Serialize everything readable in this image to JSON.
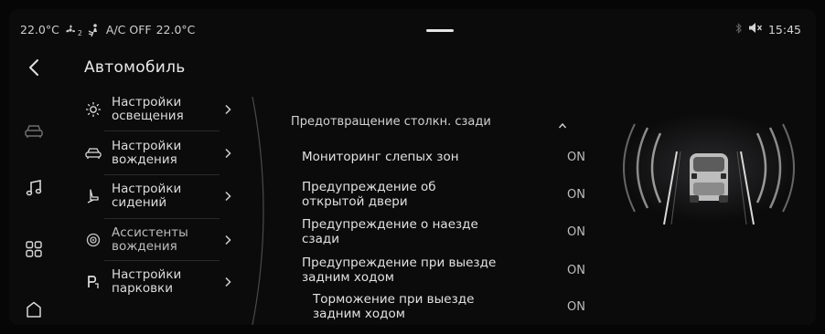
{
  "status": {
    "climate_left": "22.0°C",
    "fan_level": "2",
    "ac_status": "A/C OFF",
    "climate_right": "22.0°C",
    "time": "15:45"
  },
  "page": {
    "title": "Автомобиль"
  },
  "menu": [
    {
      "label": "Настройки\nосвещения",
      "icon": "sun-icon"
    },
    {
      "label": "Настройки\nвождения",
      "icon": "steering-car-icon"
    },
    {
      "label": "Настройки\nсидений",
      "icon": "seat-icon"
    },
    {
      "label": "Ассистенты\nвождения",
      "icon": "assist-target-icon"
    },
    {
      "label": "Настройки\nпарковки",
      "icon": "parking-icon"
    }
  ],
  "section": {
    "title": "Предотвращение столкн. сзади",
    "rows": [
      {
        "label": "Мониторинг слепых зон",
        "value": "ON"
      },
      {
        "label": "Предупреждение об\nоткрытой двери",
        "value": "ON"
      },
      {
        "label": "Предупреждение о наезде\nсзади",
        "value": "ON"
      },
      {
        "label": "Предупреждение при выезде\nзадним ходом",
        "value": "ON"
      },
      {
        "label": "Торможение при выезде\nзадним ходом",
        "value": "ON"
      }
    ]
  },
  "icons": {
    "back": "back-arrow-icon",
    "rail": [
      "car-icon",
      "music-icon",
      "apps-grid-icon",
      "home-icon"
    ]
  }
}
